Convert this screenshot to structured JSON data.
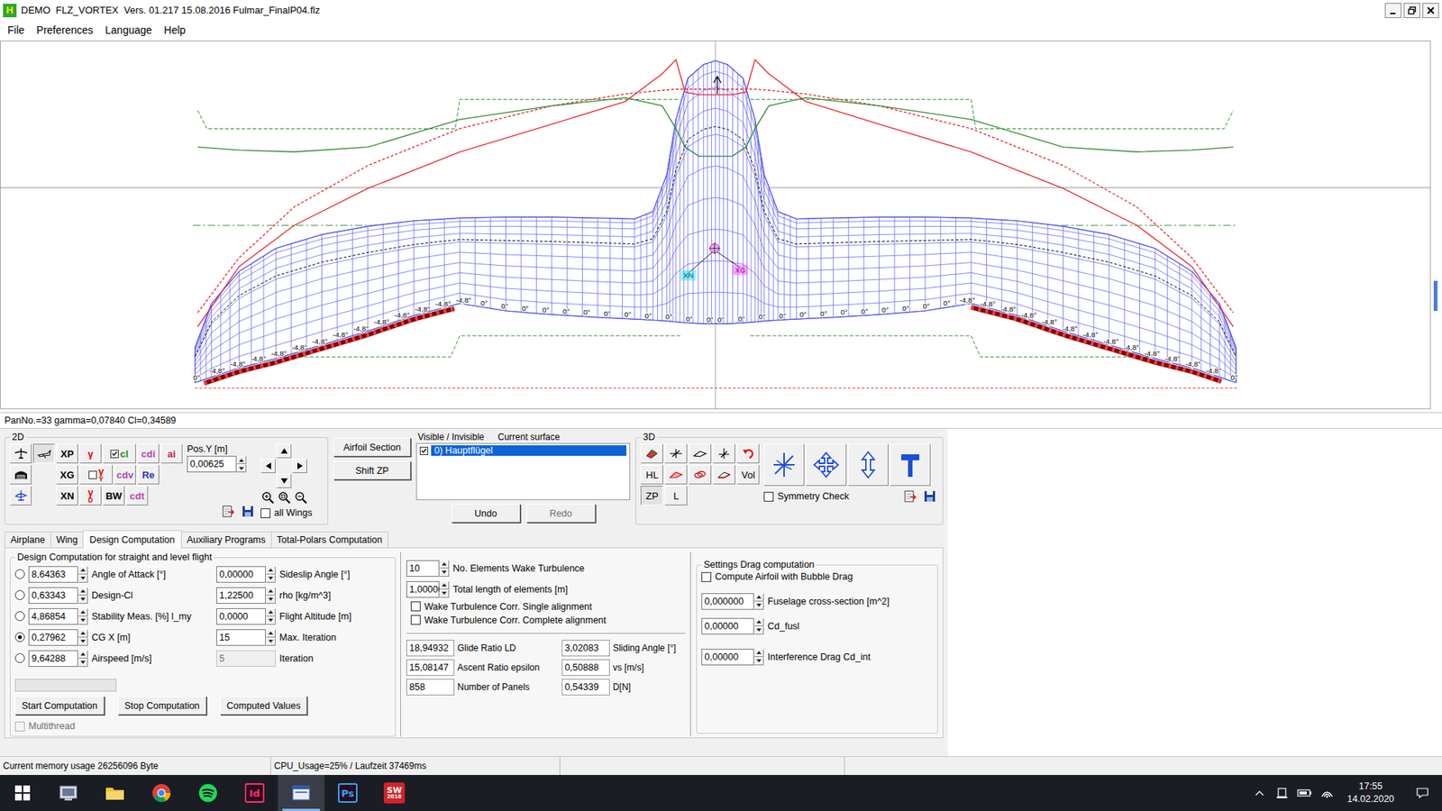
{
  "window": {
    "title": "DEMO  FLZ_VORTEX  Vers. 01.217 15.08.2016 Fulmar_FinalP04.flz",
    "app_icon_letter": "H"
  },
  "menu": [
    "File",
    "Preferences",
    "Language",
    "Help"
  ],
  "view": {
    "twist_labels_left": [
      "0°",
      "-4,8°",
      "-4,8°",
      "-4,8°",
      "-4,8°",
      "-4,8°",
      "-4,8°",
      "-4,8°",
      "-4,8°",
      "-4,8°",
      "-4,8°",
      "-4,8°",
      "-4,8°",
      "-4,8°",
      "0°",
      "0°",
      "0°",
      "0°",
      "0°",
      "0°",
      "0°",
      "0°",
      "0°",
      "0°",
      "0°",
      "0°"
    ],
    "twist_labels_right": [
      "0°",
      "0°",
      "0°",
      "0°",
      "0°",
      "0°",
      "0°",
      "0°",
      "0°",
      "0°",
      "0°",
      "0°",
      "-4,8°",
      "-4,8°",
      "-4,8°",
      "-4,8°",
      "-4,8°",
      "-4,8°",
      "-4,8°",
      "-4,8°",
      "-4,8°",
      "-4,8°",
      "-4,8°",
      "-4,8°",
      "-4,8°",
      "0°"
    ],
    "markers": [
      {
        "label": "XN",
        "color": "#00e5ee"
      },
      {
        "label": "XG",
        "color": "#ff40ff"
      }
    ],
    "curves": [
      {
        "name": "cl",
        "color": "#e8262b",
        "dashed": false,
        "values": [
          0.224,
          0.387,
          0.499,
          0.599,
          0.698,
          0.773,
          0.835,
          0.91,
          0.948,
          0.86,
          0.853,
          0.853,
          0.853,
          0.86,
          0.948,
          0.91,
          0.835,
          0.773,
          0.698,
          0.599,
          0.499,
          0.387,
          0.224
        ]
      },
      {
        "name": "cl-max",
        "color": "#e8262b",
        "dashed": true,
        "values": [
          0.262,
          0.411,
          0.549,
          0.661,
          0.761,
          0.823,
          0.855,
          0.865,
          0.868,
          0.868,
          0.868,
          0.868,
          0.868,
          0.868,
          0.868,
          0.865,
          0.855,
          0.823,
          0.761,
          0.661,
          0.549,
          0.411,
          0.262
        ]
      },
      {
        "name": "gamma",
        "color": "#2e8b2e",
        "dashed": false,
        "values": [
          0.711,
          0.703,
          0.698,
          0.711,
          0.786,
          0.823,
          0.845,
          0.823,
          0.761,
          0.711,
          0.686,
          0.686,
          0.686,
          0.711,
          0.761,
          0.823,
          0.845,
          0.823,
          0.786,
          0.711,
          0.698,
          0.703,
          0.711
        ]
      }
    ]
  },
  "info_line": "PanNo.=33 gamma=0,07840 Cl=0,34589",
  "panel_2d": {
    "title": "2D",
    "button_rows": [
      [
        {
          "label": "XP",
          "color": "#000000",
          "kind": "plain"
        },
        {
          "label": "γ",
          "color": "#e00000",
          "kind": "plain"
        },
        {
          "label": "cl",
          "color": "#109010",
          "kind": "check",
          "checked": true
        },
        {
          "label": "cdi",
          "color": "#b048b0",
          "kind": "plain"
        },
        {
          "label": "ai",
          "color": "#c02050",
          "kind": "plain"
        }
      ],
      [
        {
          "label": "XG",
          "color": "#000000",
          "kind": "plain"
        },
        {
          "label": "γ",
          "sub": "Y",
          "color": "#e00000",
          "kind": "check",
          "checked": false
        },
        {
          "label": "cdv",
          "color": "#b048b0",
          "kind": "plain"
        },
        {
          "label": "Re",
          "color": "#3030c0",
          "kind": "plain"
        }
      ],
      [
        {
          "label": "XN",
          "color": "#000000",
          "kind": "plain"
        },
        {
          "label": "γ",
          "sub": "D",
          "color": "#e00000",
          "kind": "plain"
        },
        {
          "label": "BW",
          "color": "#000000",
          "kind": "plain"
        },
        {
          "label": "cdt",
          "color": "#b048b0",
          "kind": "plain"
        }
      ]
    ],
    "pos_y": {
      "label": "Pos.Y [m]",
      "value": "0,00625"
    },
    "all_wings": {
      "label": "all Wings",
      "checked": false
    }
  },
  "side_buttons": [
    "Airfoil Section",
    "Shift ZP"
  ],
  "surfaces": {
    "header_visible": "Visible / Invisible",
    "header_current": "Current surface",
    "items": [
      {
        "label": "0) Hauptflügel",
        "visible": true,
        "selected": true
      }
    ],
    "undo": {
      "label": "Undo",
      "disabled": false
    },
    "redo": {
      "label": "Redo",
      "disabled": true
    }
  },
  "panel_3d": {
    "title": "3D",
    "buttons": [
      {
        "label": "HL",
        "pressed": false
      },
      {
        "label": "Vol",
        "pressed": false
      },
      {
        "label": "ZP",
        "pressed": true
      },
      {
        "label": "L",
        "pressed": false
      }
    ],
    "symmetry_check": {
      "label": "Symmetry Check",
      "checked": false
    }
  },
  "tabs": [
    {
      "label": "Airplane",
      "selected": false
    },
    {
      "label": "Wing",
      "selected": false
    },
    {
      "label": "Design Computation",
      "selected": true
    },
    {
      "label": "Auxiliary Programs",
      "selected": false
    },
    {
      "label": "Total-Polars Computation",
      "selected": false
    }
  ],
  "design": {
    "group_title": "Design Computation for straight and level flight",
    "targets": [
      {
        "value": "8,64363",
        "label": "Angle of Attack [°]",
        "selected": false
      },
      {
        "value": "0,63343",
        "label": "Design-Cl",
        "selected": false
      },
      {
        "value": "4,86854",
        "label": "Stability Meas. [%] l_my",
        "selected": false
      },
      {
        "value": "0,27962",
        "label": "CG X [m]",
        "selected": true
      },
      {
        "value": "9,64288",
        "label": "Airspeed [m/s]",
        "selected": false
      }
    ],
    "params": [
      {
        "value": "0,00000",
        "label": "Sideslip Angle [°]",
        "disabled": false
      },
      {
        "value": "1,22500",
        "label": "rho [kg/m^3]",
        "disabled": false
      },
      {
        "value": "0,0000",
        "label": "Flight Altitude [m]",
        "disabled": false
      },
      {
        "value": "15",
        "label": "Max. Iteration",
        "disabled": false
      },
      {
        "value": "5",
        "label": "Iteration",
        "disabled": true
      }
    ],
    "progress": {
      "level": 0
    },
    "buttons": [
      "Start Computation",
      "Stop Computation",
      "Computed Values"
    ],
    "multithread": {
      "label": "Multithread",
      "checked": false,
      "disabled": true
    }
  },
  "wake": {
    "fields": [
      {
        "value": "10",
        "label": "No. Elements Wake Turbulence"
      },
      {
        "value": "1,00000",
        "label": "Total length of elements [m]"
      }
    ],
    "options": [
      {
        "label": "Wake Turbulence Corr. Single alignment",
        "checked": false
      },
      {
        "label": "Wake Turbulence Corr. Complete alignment",
        "checked": false
      }
    ]
  },
  "results": [
    {
      "value": "18,94932",
      "label": "Glide Ratio LD"
    },
    {
      "value": "3,02083",
      "label": "Sliding Angle [°]"
    },
    {
      "value": "15,08147",
      "label": "Ascent Ratio epsilon"
    },
    {
      "value": "0,50888",
      "label": "vs [m/s]"
    },
    {
      "value": "858",
      "label": "Number of Panels"
    },
    {
      "value": "0,54339",
      "label": "D[N]"
    }
  ],
  "drag": {
    "title": "Settings Drag computation",
    "bubble": {
      "label": "Compute Airfoil with Bubble Drag",
      "checked": false
    },
    "fields": [
      {
        "value": "0,000000",
        "label": "Fuselage cross-section [m^2]"
      },
      {
        "value": "0,00000",
        "label": "Cd_fusl"
      },
      {
        "value": "0,00000",
        "label": "Interference Drag Cd_int"
      }
    ]
  },
  "status_bar": [
    "Current memory usage 26256096 Byte",
    "CPU_Usage=25% / Laufzeit 37469ms"
  ],
  "taskbar": {
    "apps": [
      {
        "kind": "explorer",
        "active": false
      },
      {
        "kind": "folder",
        "active": false
      },
      {
        "kind": "chrome",
        "active": false
      },
      {
        "kind": "spotify",
        "active": false
      },
      {
        "kind": "badge",
        "text": "Id",
        "color": "#ff3366",
        "active": false
      },
      {
        "kind": "window",
        "active": true
      },
      {
        "kind": "badge",
        "text": "Ps",
        "color": "#31a8ff",
        "active": false
      },
      {
        "kind": "badge-sw",
        "text": "SW",
        "sub": "2018",
        "color": "#d2232a",
        "active": false
      }
    ],
    "clock": {
      "time": "17:55",
      "date": "14.02.2020"
    }
  }
}
